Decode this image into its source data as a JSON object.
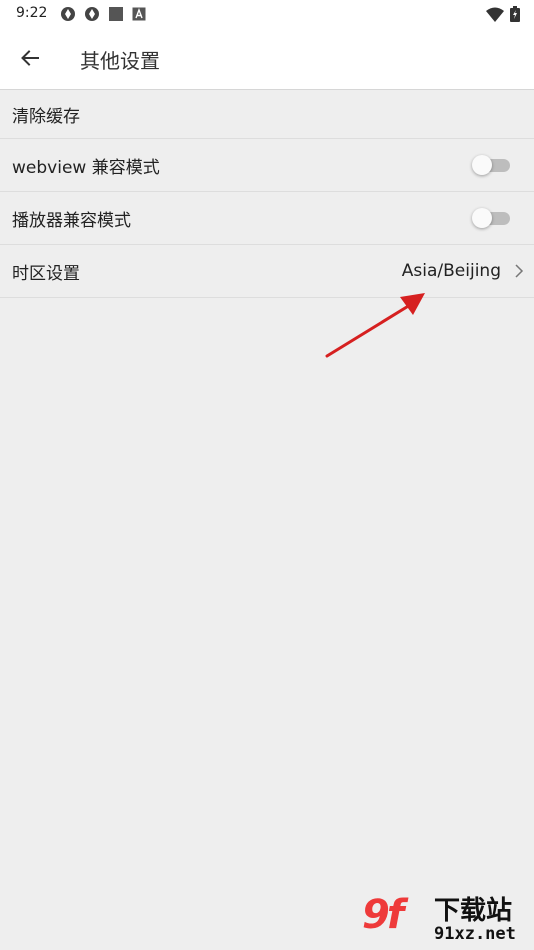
{
  "status_bar": {
    "time": "9:22",
    "left_icons": [
      "sync-icon",
      "sync-icon",
      "stop-square-icon",
      "a-badge-icon"
    ],
    "right_icons": [
      "wifi-icon",
      "battery-charging-icon"
    ]
  },
  "app_bar": {
    "back_icon": "arrow-left-icon",
    "title": "其他设置"
  },
  "settings": {
    "clear_cache": {
      "label": "清除缓存"
    },
    "webview_compat": {
      "label": "webview 兼容模式",
      "enabled": false
    },
    "player_compat": {
      "label": "播放器兼容模式",
      "enabled": false
    },
    "timezone": {
      "label": "时区设置",
      "value": "Asia/Beijing",
      "icon": "chevron-right-icon"
    }
  },
  "annotation": {
    "icon": "red-arrow-icon",
    "color": "#d62020"
  },
  "watermark": {
    "logo": "9f",
    "cn_text": "下载站",
    "url": "91xz.net",
    "accent": "#ee3a3a"
  },
  "colors": {
    "background": "#eeeeee",
    "surface": "#ffffff",
    "divider": "#dddddd",
    "switch_off_track": "#bdbdbd"
  }
}
